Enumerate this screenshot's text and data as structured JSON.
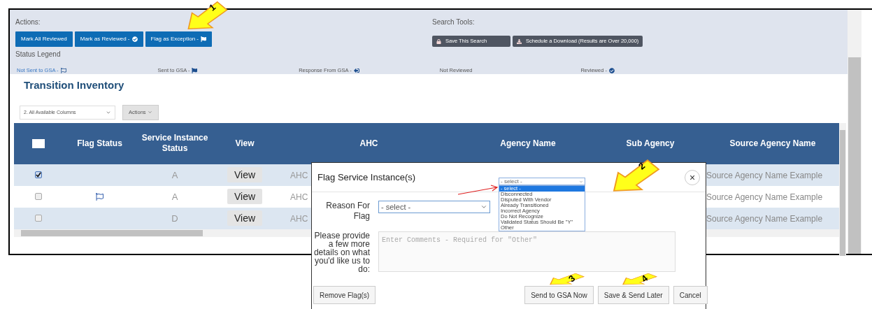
{
  "actions": {
    "label": "Actions:",
    "buttons": [
      {
        "label": "Mark All Reviewed",
        "kind": "text"
      },
      {
        "label": "Mark as Reviewed -",
        "kind": "reviewed"
      },
      {
        "label": "Flag as Exception -",
        "kind": "flag"
      }
    ]
  },
  "search_tools": {
    "label": "Search Tools:",
    "buttons": [
      {
        "label": "Save This Search",
        "kind": "lock"
      },
      {
        "label": "Schedule a Download (Results are Over 20,000)",
        "kind": "download"
      }
    ]
  },
  "status_legend": {
    "label": "Status Legend",
    "items": [
      {
        "label": "Not Sent to GSA -",
        "kind": "not-sent"
      },
      {
        "label": "Sent to GSA -",
        "kind": "sent"
      },
      {
        "label": "Response From GSA -",
        "kind": "response"
      },
      {
        "label": "Not Reviewed",
        "kind": "text"
      },
      {
        "label": "Reviewed -",
        "kind": "reviewed"
      }
    ]
  },
  "section_title": "Transition Inventory",
  "toolbar": {
    "column_set": "2. All Available Columns",
    "actions": "Actions"
  },
  "table": {
    "select_all_checked": false,
    "columns": [
      "Flag Status",
      "Service Instance Status",
      "View",
      "AHC",
      "Agency Name",
      "Sub Agency",
      "Source Agency Name"
    ],
    "rows": [
      {
        "checked": true,
        "flagged": false,
        "service_status": "A",
        "view": "View",
        "ahc": "AHC",
        "source_agency": "Source Agency Name Example"
      },
      {
        "checked": false,
        "flagged": true,
        "service_status": "A",
        "view": "View",
        "ahc": "AHC",
        "source_agency": "Source Agency Name Example"
      },
      {
        "checked": false,
        "flagged": false,
        "service_status": "D",
        "view": "View",
        "ahc": "AHC",
        "source_agency": "Source Agency Name Example"
      }
    ]
  },
  "dialog": {
    "title": "Flag Service Instance(s)",
    "close": "×",
    "reason_label": "Reason For Flag",
    "reason_value": "- select -",
    "dropdown": {
      "value": "- select -",
      "options": [
        {
          "label": "- select -",
          "selected": true
        },
        {
          "label": "Disconnected",
          "selected": false
        },
        {
          "label": "Disputed With Vendor",
          "selected": false
        },
        {
          "label": "Already Transitioned",
          "selected": false
        },
        {
          "label": "Incorrect Agency",
          "selected": false
        },
        {
          "label": "Do Not Recognize",
          "selected": false
        },
        {
          "label": "Validated Status Should Be \"Y\"",
          "selected": false
        },
        {
          "label": "Other",
          "selected": false
        }
      ]
    },
    "details_label": "Please provide a few more details on what you'd like us to do:",
    "details_placeholder": "Enter Comments - Required for \"Other\"",
    "buttons": [
      "Remove Flag(s)",
      "Send to GSA Now",
      "Save & Send Later",
      "Cancel"
    ]
  },
  "callouts": [
    "1",
    "2",
    "3",
    "4"
  ]
}
